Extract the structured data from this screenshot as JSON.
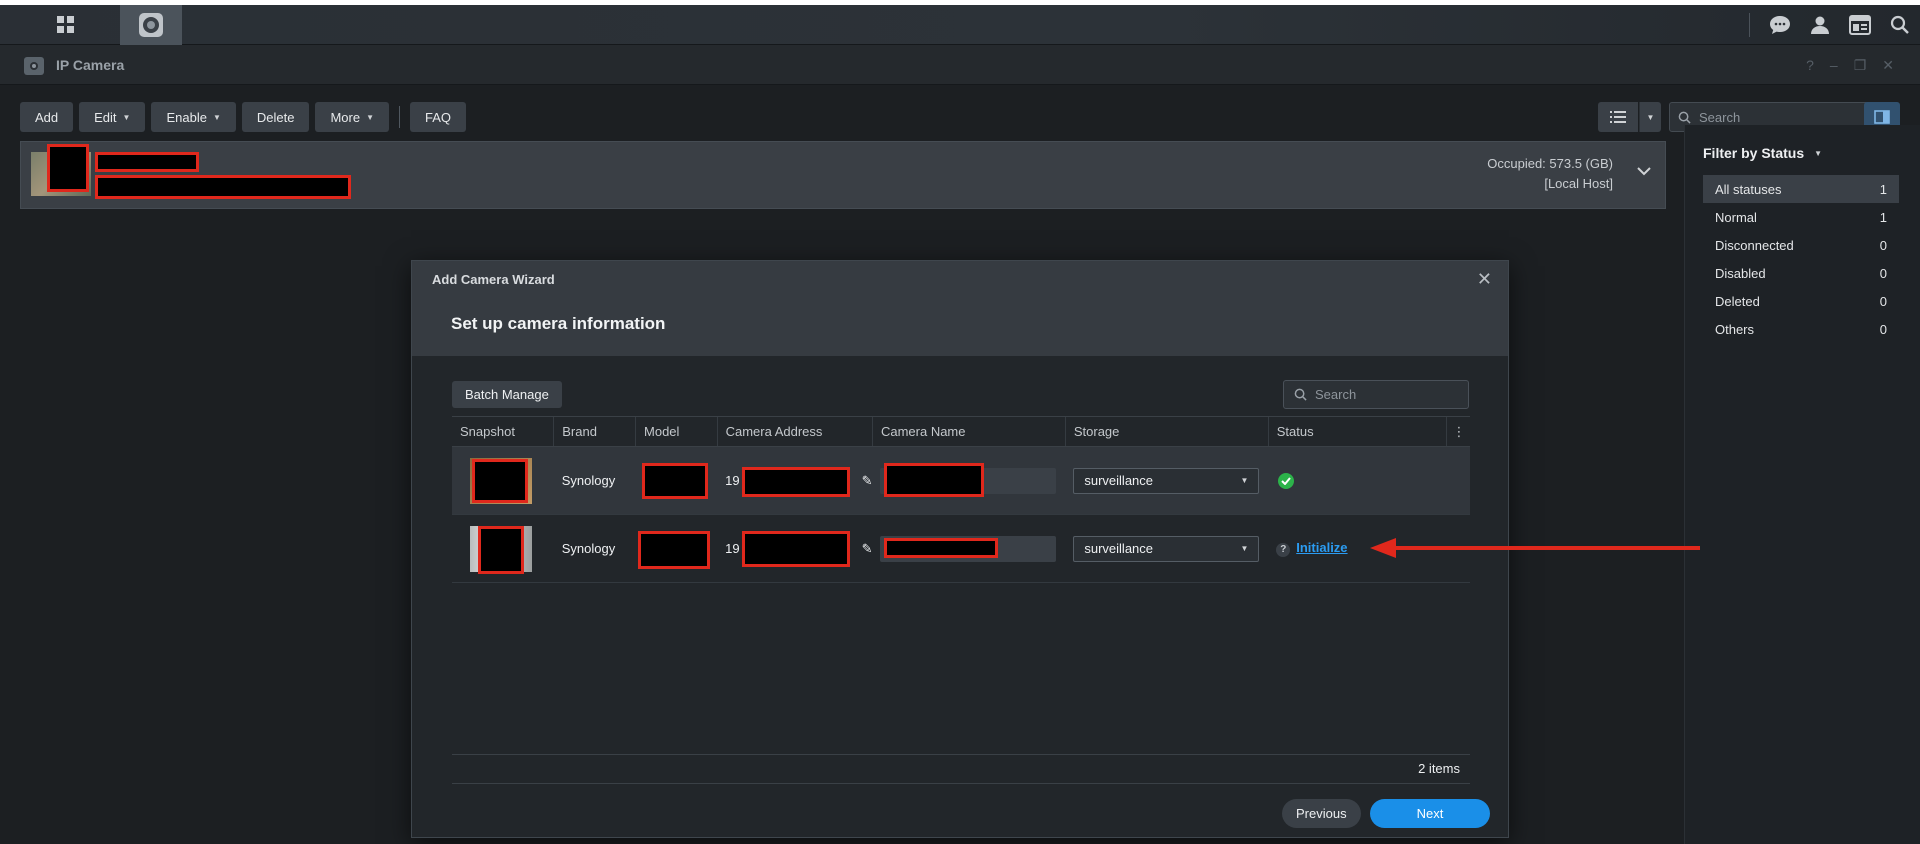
{
  "window": {
    "title": "IP Camera"
  },
  "toolbar": {
    "add": "Add",
    "edit": "Edit",
    "enable": "Enable",
    "delete": "Delete",
    "more": "More",
    "faq": "FAQ",
    "search_placeholder": "Search"
  },
  "server": {
    "occupied": "Occupied: 573.5 (GB)",
    "host": "[Local Host]"
  },
  "filter": {
    "title": "Filter by Status",
    "items": [
      {
        "label": "All statuses",
        "count": "1"
      },
      {
        "label": "Normal",
        "count": "1"
      },
      {
        "label": "Disconnected",
        "count": "0"
      },
      {
        "label": "Disabled",
        "count": "0"
      },
      {
        "label": "Deleted",
        "count": "0"
      },
      {
        "label": "Others",
        "count": "0"
      }
    ]
  },
  "wizard": {
    "title": "Add Camera Wizard",
    "step": "Set up camera information",
    "batch_manage": "Batch Manage",
    "search_placeholder": "Search",
    "columns": [
      "Snapshot",
      "Brand",
      "Model",
      "Camera Address",
      "Camera Name",
      "Storage",
      "Status"
    ],
    "rows": [
      {
        "brand": "Synology",
        "address_prefix": "19",
        "storage": "surveillance",
        "status": "ok"
      },
      {
        "brand": "Synology",
        "address_prefix": "19",
        "storage": "surveillance",
        "status_link": "Initialize"
      }
    ],
    "items_count": "2 items",
    "previous": "Previous",
    "next": "Next"
  },
  "colors": {
    "accent": "#1a8fe8",
    "link": "#2b9cf2",
    "ok": "#2cb34a",
    "annotation_arrow": "#e0281c"
  }
}
